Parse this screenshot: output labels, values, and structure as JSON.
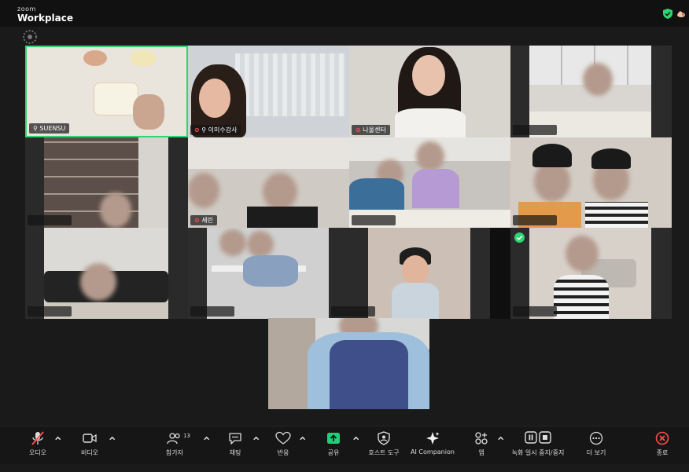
{
  "app": {
    "brand_small": "zoom",
    "brand_big": "Workplace"
  },
  "colors": {
    "active_border": "#2ed573",
    "mic_off": "#ff4d4d",
    "share": "#1fd07a",
    "end": "#ff4d4d"
  },
  "tiles": [
    {
      "name": "SUENSU",
      "pinned": true,
      "mic_off": false,
      "active": true
    },
    {
      "name": "이미수강사",
      "pinned": true,
      "mic_off": true
    },
    {
      "name": "나울센터",
      "mic_off": true
    },
    {
      "name": ""
    },
    {
      "name": ""
    },
    {
      "name": "세린",
      "mic_off": true
    },
    {
      "name": ""
    },
    {
      "name": ""
    },
    {
      "name": ""
    },
    {
      "name": ""
    },
    {
      "name": ""
    },
    {
      "name": ""
    }
  ],
  "toolbar": {
    "audio": "오디오",
    "video": "비디오",
    "participants": "참가자",
    "participants_count": "13",
    "chat": "채팅",
    "reactions": "반응",
    "share": "공유",
    "host_tools": "호스트 도구",
    "ai_companion": "AI Companion",
    "apps": "앱",
    "record": "녹화 일시 중지/중지",
    "more": "더 보기",
    "end": "종료"
  }
}
